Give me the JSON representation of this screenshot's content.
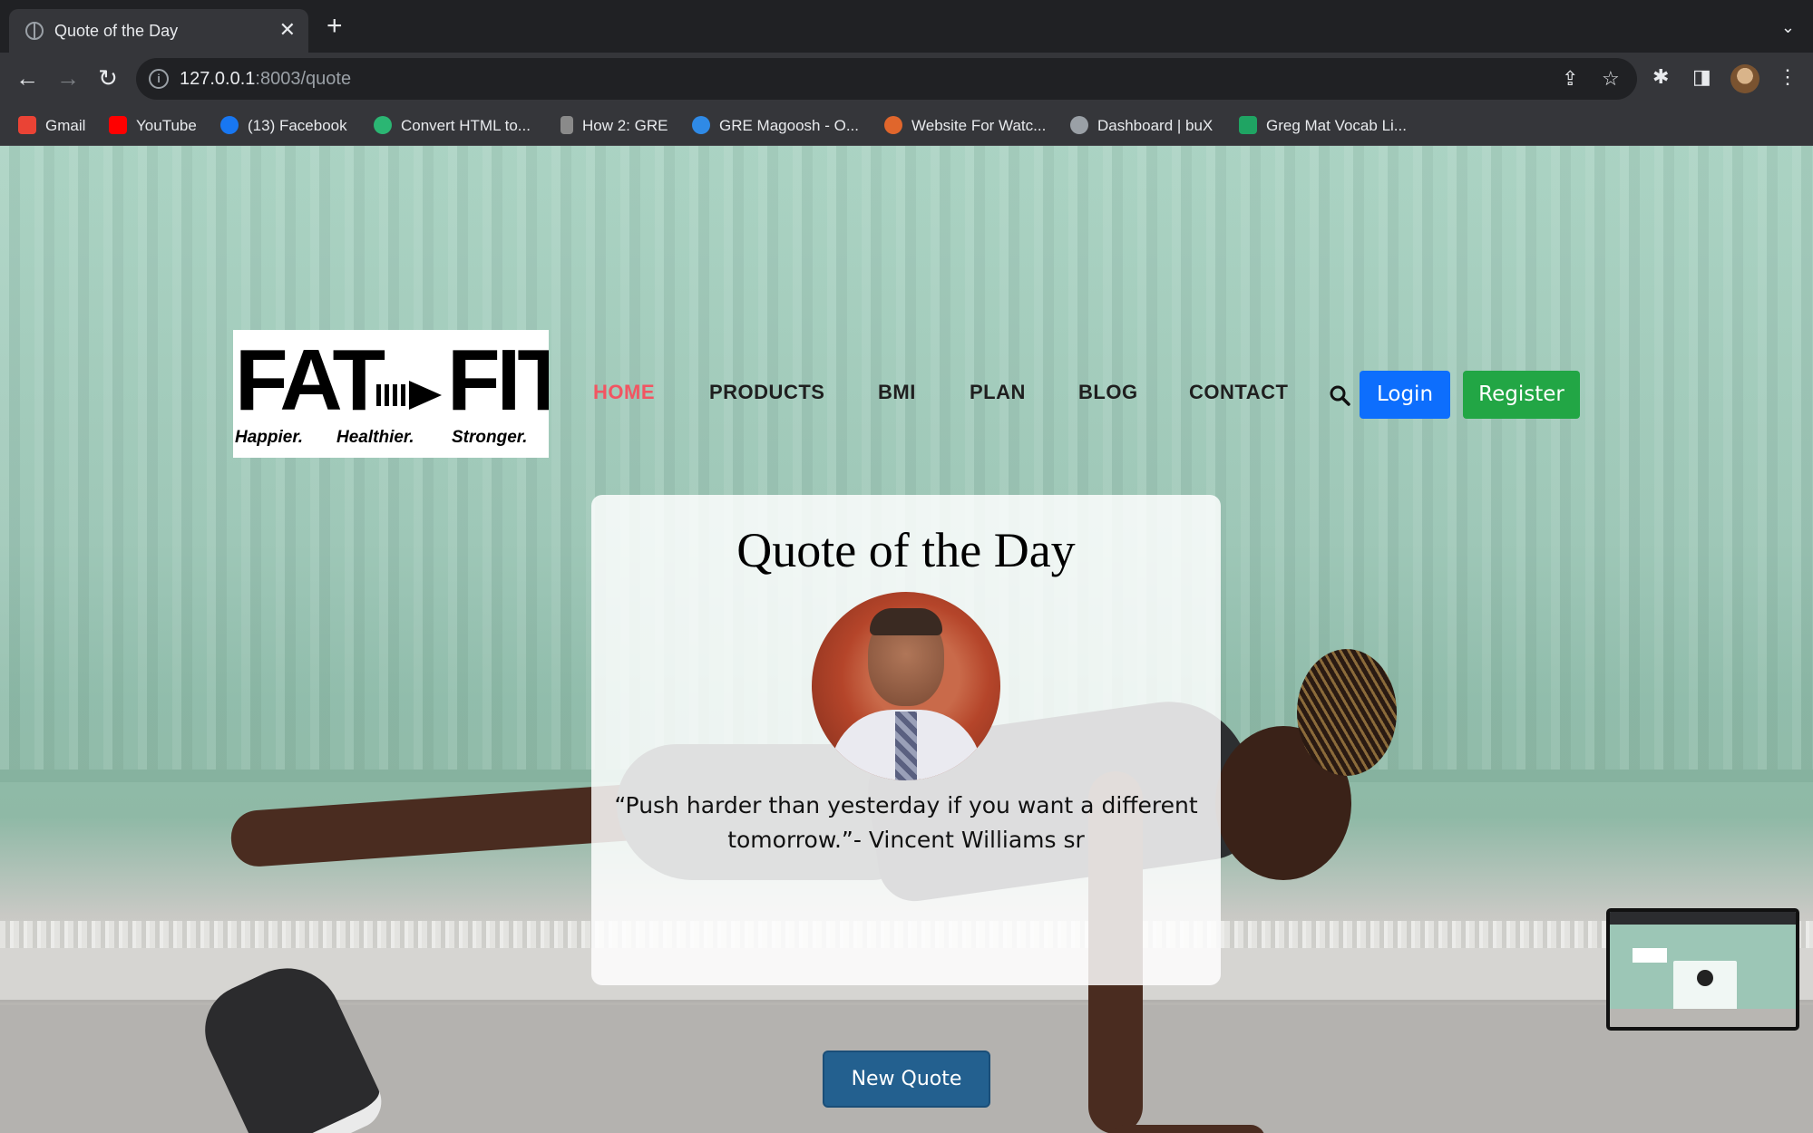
{
  "browser": {
    "tab_title": "Quote of the Day",
    "tab_close": "✕",
    "new_tab": "+",
    "tab_search": "⌄",
    "url_host": "127.0.0.1",
    "url_path": ":8003/quote",
    "bookmarks": [
      {
        "label": "Gmail",
        "color": "#ea4335"
      },
      {
        "label": "YouTube",
        "color": "#ff0000"
      },
      {
        "label": "(13) Facebook",
        "color": "#1877f2"
      },
      {
        "label": "Convert HTML to...",
        "color": "#2bb673"
      },
      {
        "label": "How 2: GRE",
        "color": "#8a8a8a"
      },
      {
        "label": "GRE Magoosh - O...",
        "color": "#2f8ae6"
      },
      {
        "label": "Website For Watc...",
        "color": "#e0662c"
      },
      {
        "label": "Dashboard | buX",
        "color": "#9aa0a6"
      },
      {
        "label": "Greg Mat Vocab Li...",
        "color": "#1fa463"
      }
    ]
  },
  "site": {
    "logo": {
      "left_word": "FAT",
      "right_word": "FIT",
      "tagline": [
        "Happier.",
        "Healthier.",
        "Stronger."
      ]
    },
    "nav": [
      {
        "label": "HOME",
        "active": true
      },
      {
        "label": "PRODUCTS",
        "active": false
      },
      {
        "label": "BMI",
        "active": false
      },
      {
        "label": "PLAN",
        "active": false
      },
      {
        "label": "BLOG",
        "active": false
      },
      {
        "label": "CONTACT",
        "active": false
      }
    ],
    "login_label": "Login",
    "register_label": "Register",
    "colors": {
      "nav_active": "#f25562",
      "login": "#0d6efd",
      "register": "#22a645",
      "new_quote": "#23608f"
    }
  },
  "quote_card": {
    "title": "Quote of the Day",
    "quote_text": "“Push harder than yesterday if you want a different tomorrow.”- Vincent Williams sr",
    "button_label": "New Quote"
  }
}
